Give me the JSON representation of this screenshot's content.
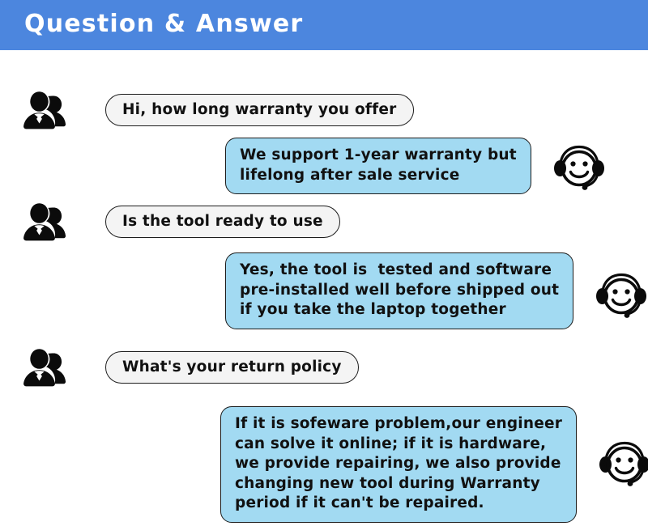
{
  "header": {
    "title": "Question & Answer",
    "background_color": "#4c86de",
    "text_color": "#ffffff"
  },
  "colors": {
    "header_blue": "#4c86de",
    "answer_bubble_blue": "#a2daf2",
    "question_bubble_gray": "#f4f4f4",
    "outline_black": "#1c1c1c",
    "text_black": "#111111",
    "page_background": "#ffffff"
  },
  "icons": {
    "user": "user-avatar-icon",
    "agent": "headset-smiley-icon"
  },
  "conversation": [
    {
      "role": "question",
      "speaker_icon": "user-avatar-icon",
      "text": "Hi, how long warranty you offer"
    },
    {
      "role": "answer",
      "speaker_icon": "headset-smiley-icon",
      "text": "We support 1-year warranty but\nlifelong after sale service"
    },
    {
      "role": "question",
      "speaker_icon": "user-avatar-icon",
      "text": "Is the tool ready to use"
    },
    {
      "role": "answer",
      "speaker_icon": "headset-smiley-icon",
      "text": "Yes, the tool is  tested and software\npre-installed well before shipped out\nif you take the laptop together"
    },
    {
      "role": "question",
      "speaker_icon": "user-avatar-icon",
      "text": "What's your return policy"
    },
    {
      "role": "answer",
      "speaker_icon": "headset-smiley-icon",
      "text": "If it is sofeware problem,our engineer\ncan solve it online; if it is hardware,\nwe provide repairing, we also provide\nchanging new tool during Warranty\nperiod if it can't be repaired."
    }
  ]
}
